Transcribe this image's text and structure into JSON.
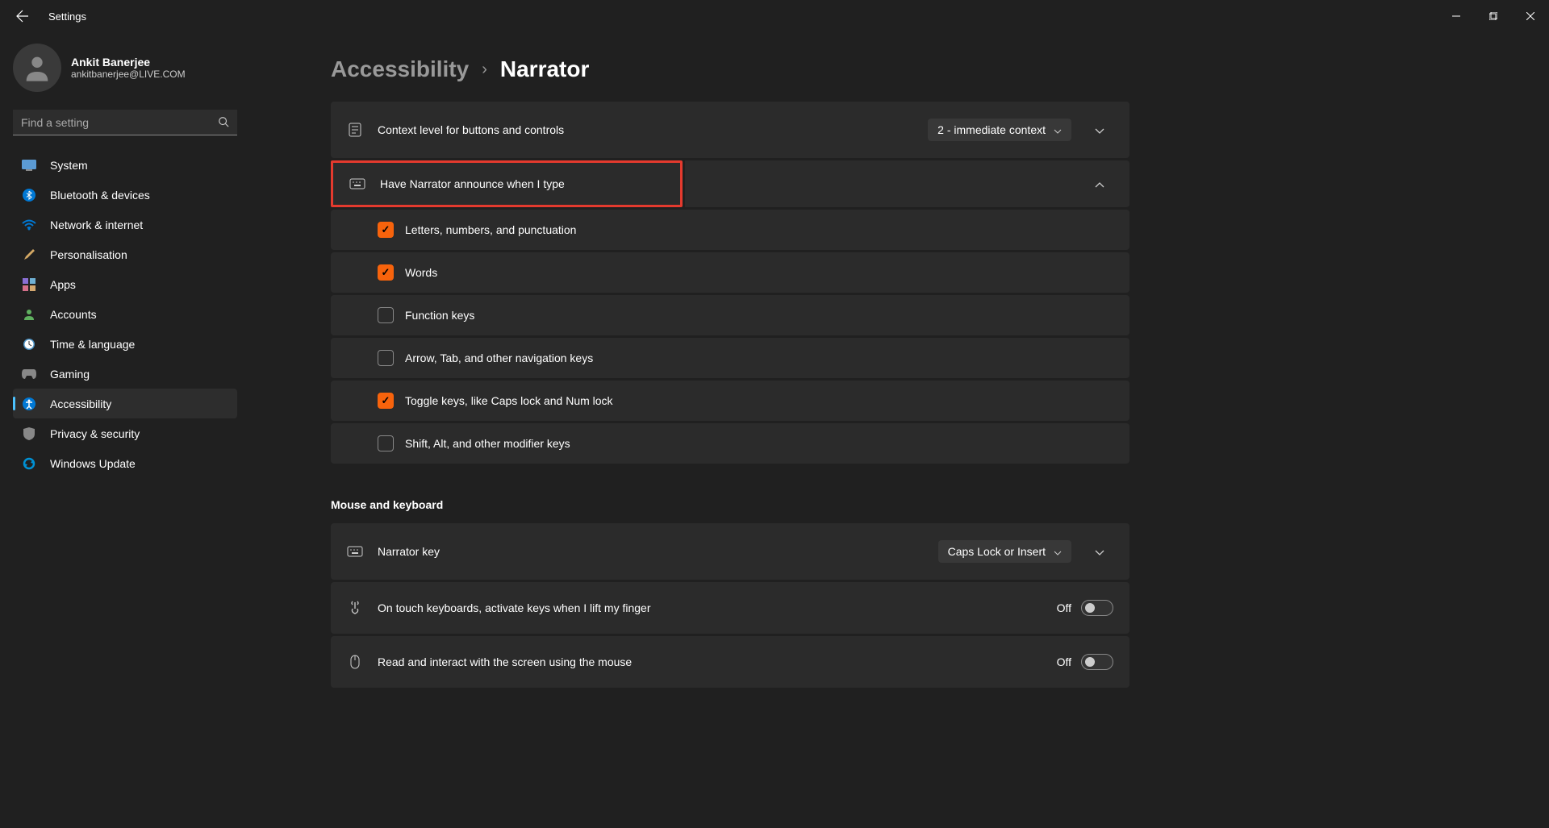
{
  "app_title": "Settings",
  "user": {
    "name": "Ankit Banerjee",
    "email": "ankitbanerjee@LIVE.COM"
  },
  "search": {
    "placeholder": "Find a setting"
  },
  "nav": {
    "items": [
      {
        "label": "System",
        "icon": "💻"
      },
      {
        "label": "Bluetooth & devices",
        "icon": "bt"
      },
      {
        "label": "Network & internet",
        "icon": "📶"
      },
      {
        "label": "Personalisation",
        "icon": "🖌️"
      },
      {
        "label": "Apps",
        "icon": "▦"
      },
      {
        "label": "Accounts",
        "icon": "👤"
      },
      {
        "label": "Time & language",
        "icon": "🕐"
      },
      {
        "label": "Gaming",
        "icon": "🎮"
      },
      {
        "label": "Accessibility",
        "icon": "♿"
      },
      {
        "label": "Privacy & security",
        "icon": "🛡️"
      },
      {
        "label": "Windows Update",
        "icon": "🔄"
      }
    ]
  },
  "breadcrumb": {
    "parent": "Accessibility",
    "current": "Narrator"
  },
  "settings": {
    "context_level": {
      "label": "Context level for buttons and controls",
      "value": "2 - immediate context"
    },
    "announce_type": {
      "label": "Have Narrator announce when I type"
    },
    "checkboxes": [
      {
        "label": "Letters, numbers, and punctuation",
        "checked": true
      },
      {
        "label": "Words",
        "checked": true
      },
      {
        "label": "Function keys",
        "checked": false
      },
      {
        "label": "Arrow, Tab, and other navigation keys",
        "checked": false
      },
      {
        "label": "Toggle keys, like Caps lock and Num lock",
        "checked": true
      },
      {
        "label": "Shift, Alt, and other modifier keys",
        "checked": false
      }
    ],
    "section_mouse": "Mouse and keyboard",
    "narrator_key": {
      "label": "Narrator key",
      "value": "Caps Lock or Insert"
    },
    "touch_kb": {
      "label": "On touch keyboards, activate keys when I lift my finger",
      "state": "Off"
    },
    "mouse_read": {
      "label": "Read and interact with the screen using the mouse",
      "state": "Off"
    }
  }
}
